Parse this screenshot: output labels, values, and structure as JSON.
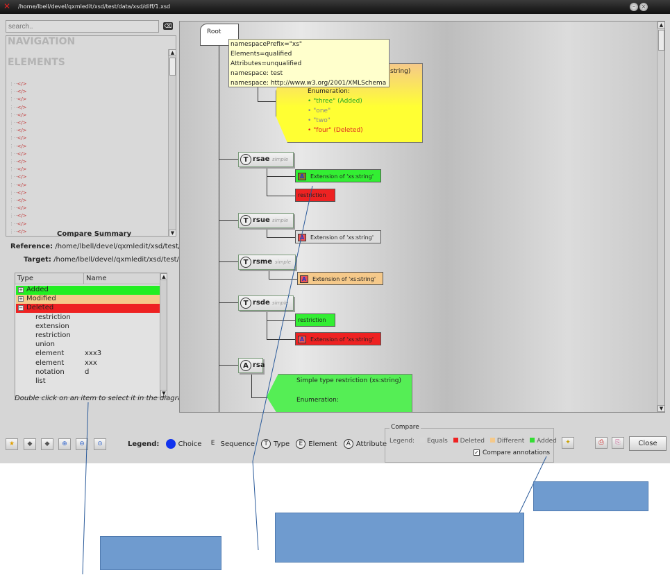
{
  "window": {
    "title": "/home/lbell/devel/qxmledit/xsd/test/data/xsd/diff/1.xsd"
  },
  "left_panel": {
    "search_placeholder": "search..",
    "navigation_label": "NAVIGATION",
    "elements_label": "ELEMENTS",
    "element_item_label": "</>",
    "compare_summary_title": "Compare Summary",
    "reference_label": "Reference:",
    "reference_path": "/home/lbell/devel/qxmledit/xsd/test/da",
    "target_label": "Target:",
    "target_path": "/home/lbell/devel/qxmledit/xsd/test/da",
    "table_headers": [
      "Type",
      "Name"
    ],
    "table_rows": [
      {
        "type": "Added",
        "name": "",
        "status": "added"
      },
      {
        "type": "Modified",
        "name": "",
        "status": "modified"
      },
      {
        "type": "Deleted",
        "name": "",
        "status": "deleted"
      },
      {
        "type": "restriction",
        "name": ""
      },
      {
        "type": "extension",
        "name": ""
      },
      {
        "type": "restriction",
        "name": ""
      },
      {
        "type": "union",
        "name": ""
      },
      {
        "type": "element",
        "name": "xxx3"
      },
      {
        "type": "element",
        "name": "xxx"
      },
      {
        "type": "notation",
        "name": "d"
      },
      {
        "type": "list",
        "name": ""
      }
    ],
    "hint": "Double click on an item to select it in the diagram"
  },
  "diagram": {
    "root_label": "Root",
    "tooltip_lines": [
      "namespacePrefix=\"xs\"",
      "Elements=qualified",
      "Attributes=unqualified",
      "namespace: test",
      "namespace: http://www.w3.org/2001/XMLSchema"
    ],
    "yellow_block": {
      "partial_header": "string)",
      "enumeration_label": "Enumeration:",
      "items": [
        "\"three\" (Added)",
        "\"one\"",
        "\"two\"",
        "\"four\" (Deleted)"
      ]
    },
    "nodes": [
      {
        "symbol": "T",
        "name": "rsae",
        "kind": "simple"
      },
      {
        "symbol": "T",
        "name": "rsue",
        "kind": "simple"
      },
      {
        "symbol": "T",
        "name": "rsme",
        "kind": "simple"
      },
      {
        "symbol": "T",
        "name": "rsde",
        "kind": "simple"
      },
      {
        "symbol": "A",
        "name": "rsa",
        "kind": ""
      }
    ],
    "boxes": {
      "rsae_ext": "Extension of 'xs:string'",
      "rsae_restr": "restriction",
      "rsue_ext": "Extension of 'xs:string'",
      "rsme_ext": "Extension of 'xs:string'",
      "rsde_restr": "restriction",
      "rsde_ext": "Extension of 'xs:string'",
      "a_icon": "A"
    },
    "green_block": {
      "header": "Simple type restriction (xs:string)",
      "enumeration_label": "Enumeration:"
    }
  },
  "toolbar": {
    "legend_label": "Legend:",
    "legend_items": [
      {
        "symbol": "",
        "label": "Choice"
      },
      {
        "symbol": "E",
        "label": "Sequence"
      },
      {
        "symbol": "T",
        "label": "Type"
      },
      {
        "symbol": "E",
        "label": "Element"
      },
      {
        "symbol": "A",
        "label": "Attribute"
      }
    ],
    "compare_group_title": "Compare",
    "compare_legend_label": "Legend:",
    "compare_legend": [
      {
        "label": "Equals",
        "color": "#d8d8d8"
      },
      {
        "label": "Deleted",
        "color": "#ee2222"
      },
      {
        "label": "Different",
        "color": "#f5c98a"
      },
      {
        "label": "Added",
        "color": "#33dd33"
      }
    ],
    "compare_annotations_label": "Compare annotations",
    "compare_annotations_checked": "✓",
    "close_label": "Close"
  },
  "colors": {
    "added": "#22ee22",
    "modified": "#f5c98a",
    "deleted": "#ee2222",
    "callout": "#6f9bcf"
  },
  "icons": [
    "x-app-icon",
    "minimize-icon",
    "close-window-icon",
    "clear-search-icon",
    "star-icon",
    "back-icon",
    "forward-icon",
    "zoom-in-icon",
    "zoom-out-icon",
    "zoom-reset-icon",
    "wand-icon",
    "pdf-icon",
    "print-icon"
  ]
}
